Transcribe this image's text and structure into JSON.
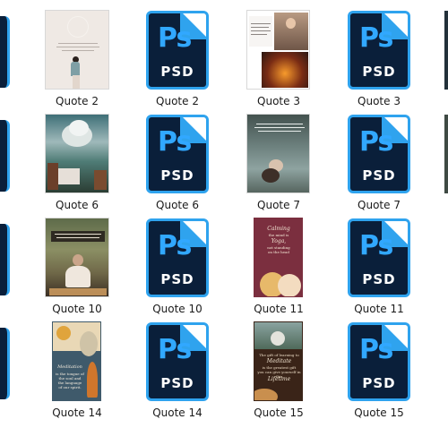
{
  "explorer": {
    "files": [
      {
        "name": "Quote 2",
        "kind": "image",
        "thumb": "quote2"
      },
      {
        "name": "Quote 2",
        "kind": "psd"
      },
      {
        "name": "Quote 3",
        "kind": "image",
        "thumb": "quote3"
      },
      {
        "name": "Quote 3",
        "kind": "psd"
      },
      {
        "name": "Quote 6",
        "kind": "image",
        "thumb": "quote6"
      },
      {
        "name": "Quote 6",
        "kind": "psd"
      },
      {
        "name": "Quote 7",
        "kind": "image",
        "thumb": "quote7"
      },
      {
        "name": "Quote 7",
        "kind": "psd"
      },
      {
        "name": "Quote 10",
        "kind": "image",
        "thumb": "quote10"
      },
      {
        "name": "Quote 10",
        "kind": "psd"
      },
      {
        "name": "Quote 11",
        "kind": "image",
        "thumb": "quote11"
      },
      {
        "name": "Quote 11",
        "kind": "psd"
      },
      {
        "name": "Quote 14",
        "kind": "image",
        "thumb": "quote14"
      },
      {
        "name": "Quote 14",
        "kind": "psd"
      },
      {
        "name": "Quote 15",
        "kind": "image",
        "thumb": "quote15"
      },
      {
        "name": "Quote 15",
        "kind": "psd"
      }
    ],
    "psd_icon": {
      "badge": "Ps",
      "extension": "PSD"
    },
    "thumb_text": {
      "quote11": [
        "Calming",
        "the mind is",
        "Yoga,",
        "not standing",
        "on the head"
      ],
      "quote14": [
        "Meditation",
        "is the tongue of",
        "the soul and",
        "the language",
        "of our spirit."
      ],
      "quote15": [
        "The gift of learning to",
        "Meditate",
        "is the greatest gift",
        "you can give yourself in this",
        "Lifetime"
      ]
    },
    "colors": {
      "psd_bg": "#0a1f3a",
      "psd_accent": "#31a8ff",
      "label": "#1b1b1b"
    }
  }
}
